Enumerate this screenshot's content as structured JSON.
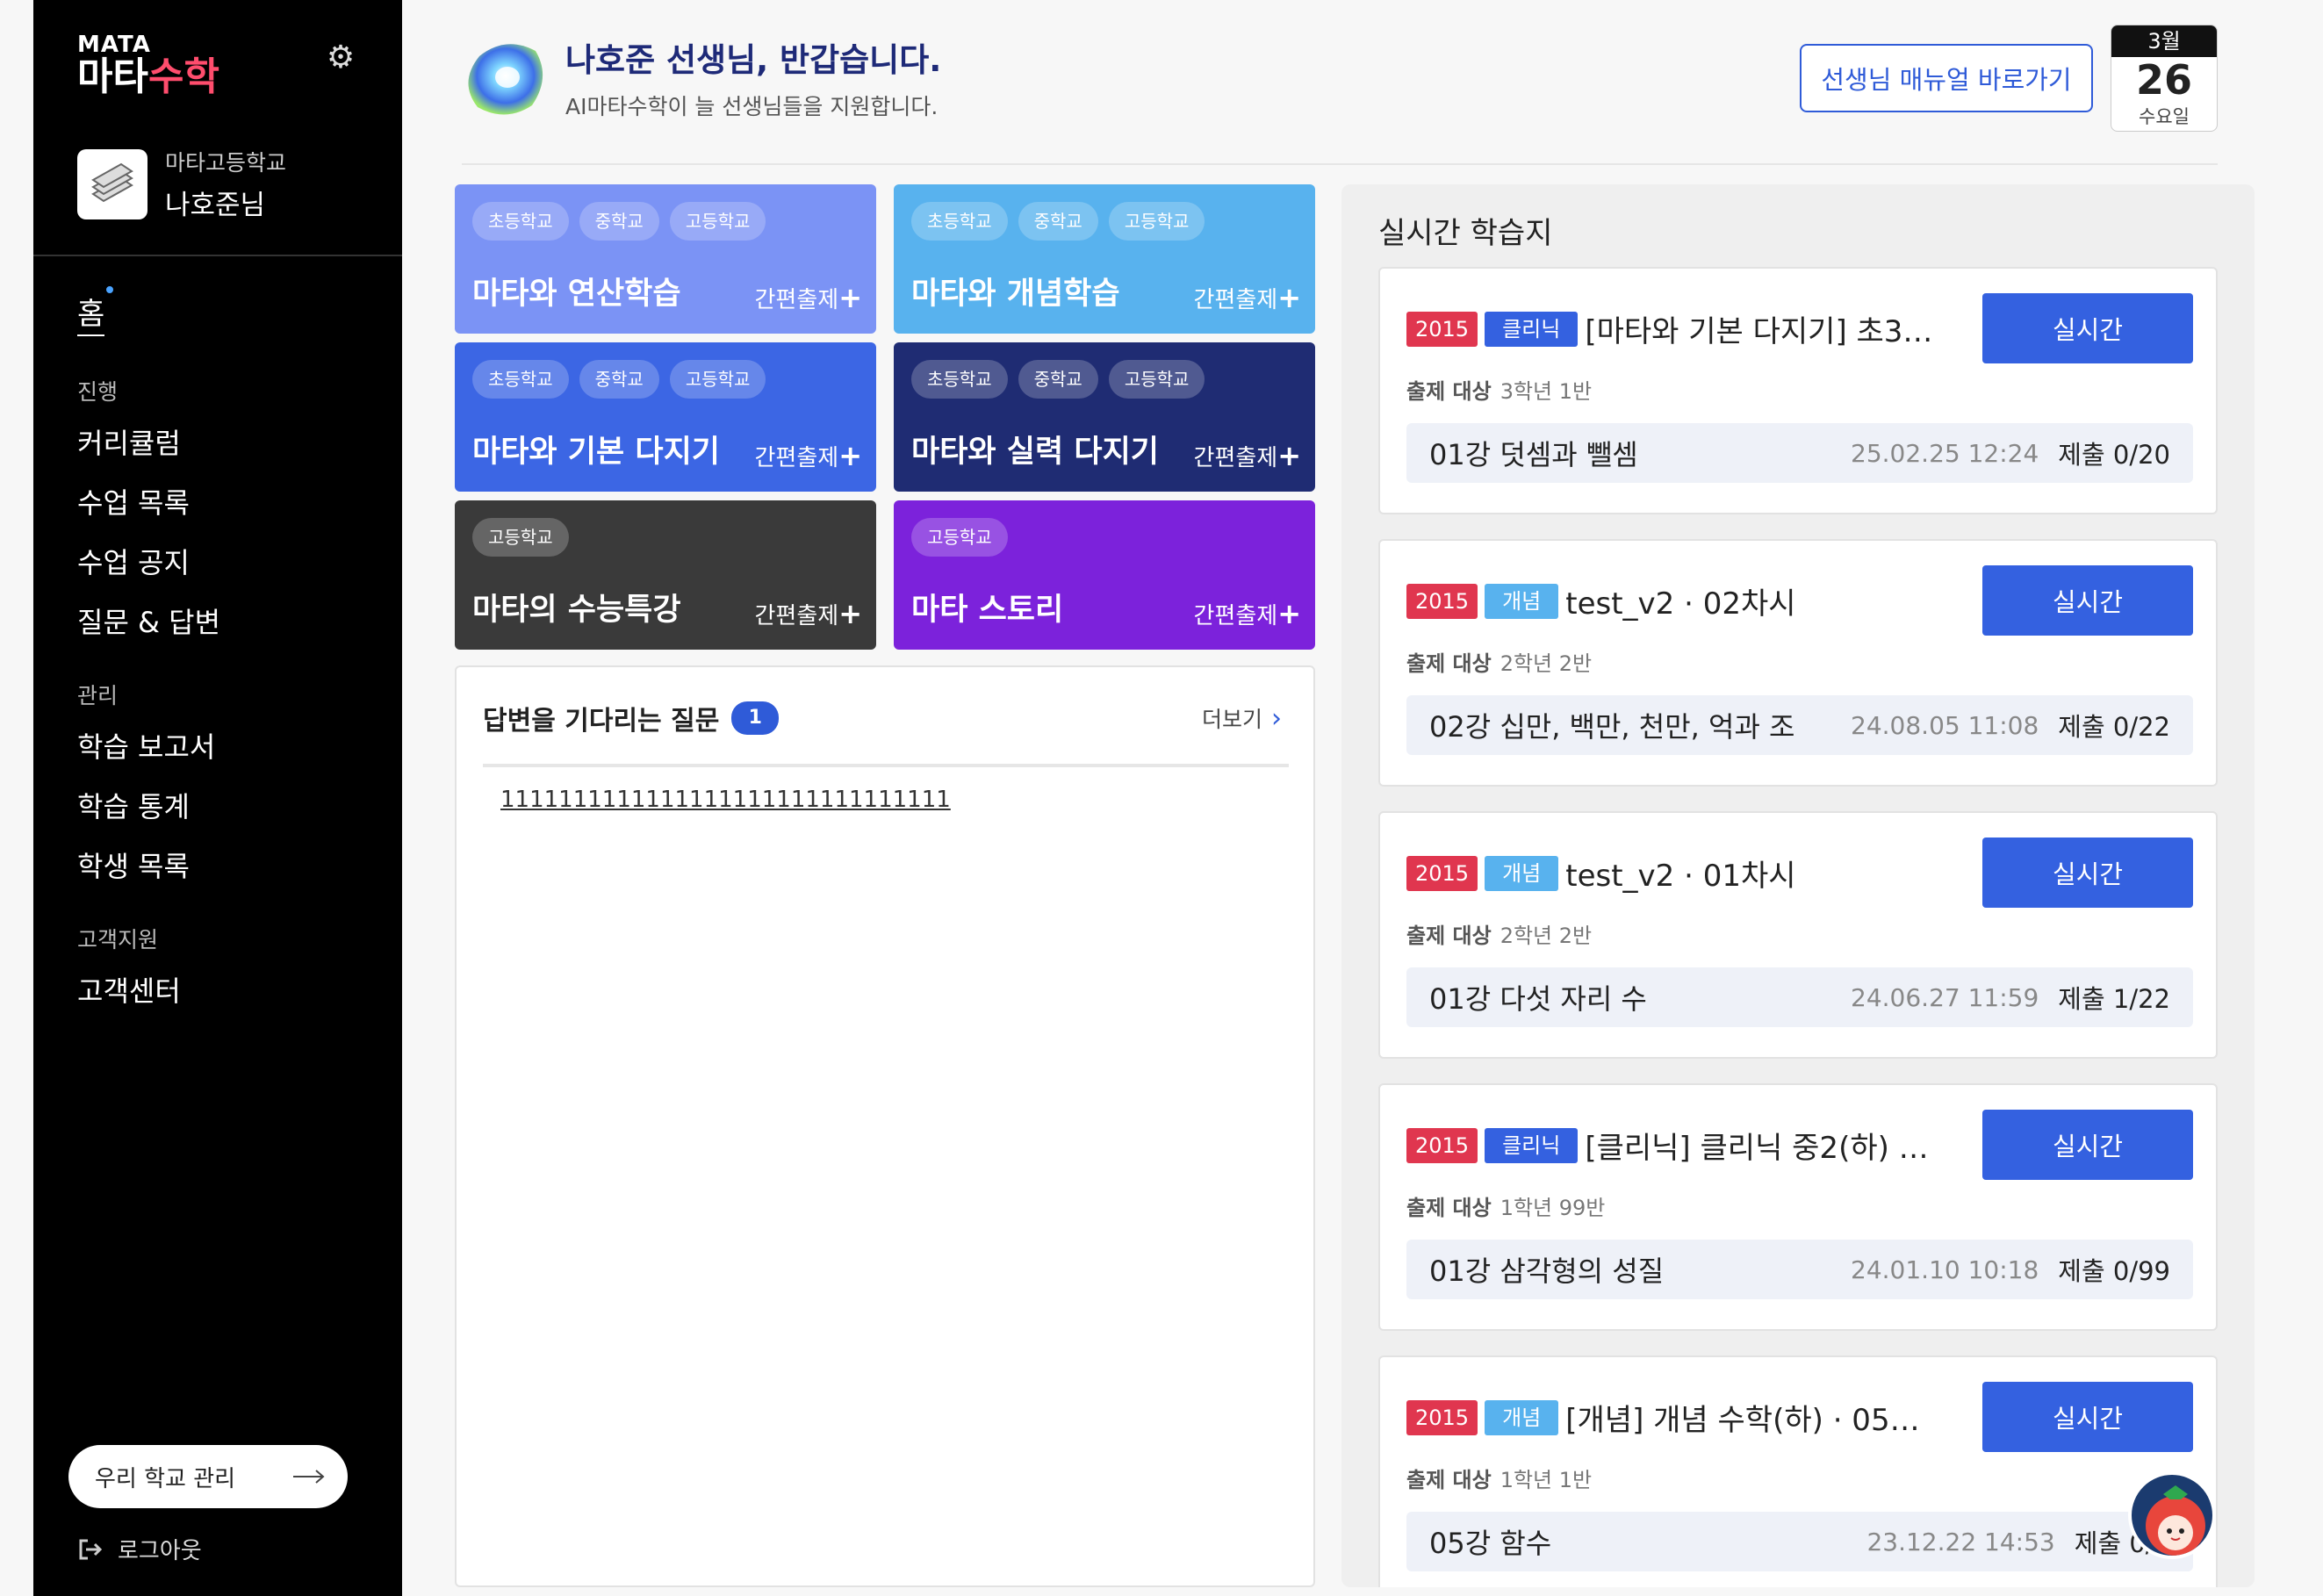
{
  "sidebar": {
    "logo_small": "MATA",
    "logo_main_white": "마타",
    "logo_main_pink": "수학",
    "school": "마타고등학교",
    "teacher": "나호준님",
    "home": "홈",
    "groups": [
      {
        "label": "진행",
        "items": [
          "커리큘럼",
          "수업 목록",
          "수업 공지",
          "질문 & 답변"
        ]
      },
      {
        "label": "관리",
        "items": [
          "학습 보고서",
          "학습 통계",
          "학생 목록"
        ]
      },
      {
        "label": "고객지원",
        "items": [
          "고객센터"
        ]
      }
    ],
    "school_manage": "우리 학교 관리",
    "logout": "로그아웃"
  },
  "header": {
    "greeting": "나호준 선생님, 반갑습니다.",
    "sub": "AI마타수학이 늘 선생님들을 지원합니다.",
    "manual_button": "선생님 매뉴얼 바로가기",
    "date": {
      "month": "3월",
      "day": "26",
      "weekday": "수요일"
    }
  },
  "tiles": [
    {
      "tags": [
        "초등학교",
        "중학교",
        "고등학교"
      ],
      "title": "마타와 연산학습",
      "quick": "간편출제",
      "color": "#7b93f5"
    },
    {
      "tags": [
        "초등학교",
        "중학교",
        "고등학교"
      ],
      "title": "마타와 개념학습",
      "quick": "간편출제",
      "color": "#58b2ee"
    },
    {
      "tags": [
        "초등학교",
        "중학교",
        "고등학교"
      ],
      "title": "마타와 기본 다지기",
      "quick": "간편출제",
      "color": "#3c66e4"
    },
    {
      "tags": [
        "초등학교",
        "중학교",
        "고등학교"
      ],
      "title": "마타와 실력 다지기",
      "quick": "간편출제",
      "color": "#1f2c73"
    },
    {
      "tags": [
        "고등학교"
      ],
      "title": "마타의 수능특강",
      "quick": "간편출제",
      "color": "#3a3a3a"
    },
    {
      "tags": [
        "고등학교"
      ],
      "title": "마타 스토리",
      "quick": "간편출제",
      "color": "#7c22db"
    }
  ],
  "qa": {
    "title": "답변을 기다리는 질문",
    "count": "1",
    "more": "더보기",
    "items": [
      "1111111111111111111111111111111"
    ]
  },
  "realtime": {
    "title": "실시간 학습지",
    "button_label": "실시간",
    "target_label": "출제 대상",
    "cards": [
      {
        "year": "2015",
        "type": "클리닉",
        "type_color": "#3461e0",
        "title": "[마타와 기본 다지기] 초3…",
        "target": "3학년 1반",
        "lesson": "01강 덧셈과 뺄셈",
        "date": "25.02.25 12:24",
        "submit": "제출 0/20"
      },
      {
        "year": "2015",
        "type": "개념",
        "type_color": "#58b2ee",
        "title": "test_v2 · 02차시",
        "target": "2학년 2반",
        "lesson": "02강 십만, 백만, 천만, 억과 조",
        "date": "24.08.05 11:08",
        "submit": "제출 0/22"
      },
      {
        "year": "2015",
        "type": "개념",
        "type_color": "#58b2ee",
        "title": "test_v2 · 01차시",
        "target": "2학년 2반",
        "lesson": "01강 다섯 자리 수",
        "date": "24.06.27 11:59",
        "submit": "제출 1/22"
      },
      {
        "year": "2015",
        "type": "클리닉",
        "type_color": "#3461e0",
        "title": "[클리닉] 클리닉 중2(하) …",
        "target": "1학년 99반",
        "lesson": "01강 삼각형의 성질",
        "date": "24.01.10 10:18",
        "submit": "제출 0/99"
      },
      {
        "year": "2015",
        "type": "개념",
        "type_color": "#58b2ee",
        "title": "[개념] 개념 수학(하) · 05…",
        "target": "1학년 1반",
        "lesson": "05강 함수",
        "date": "23.12.22 14:53",
        "submit": "제출 0/1"
      }
    ]
  }
}
